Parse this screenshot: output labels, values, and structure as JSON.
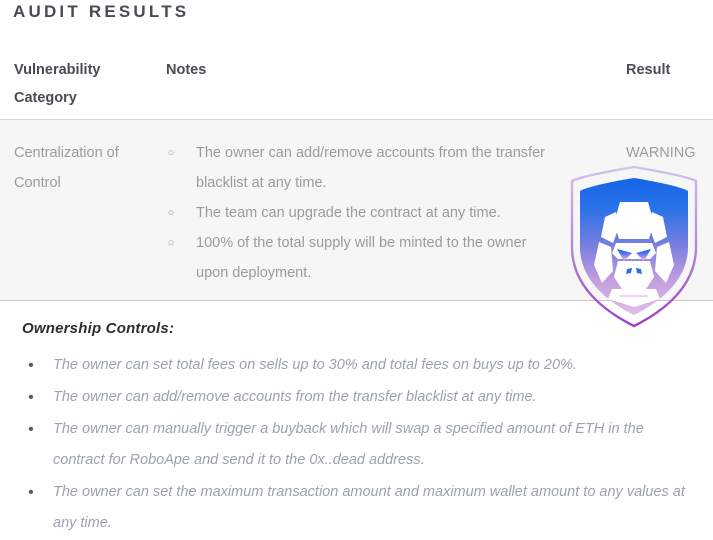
{
  "page": {
    "title": "AUDIT RESULTS"
  },
  "table": {
    "headers": {
      "category": "Vulnerability Category",
      "notes": "Notes",
      "result": "Result"
    },
    "rows": [
      {
        "category": "Centralization of Control",
        "notes": [
          "The owner can add/remove accounts from the transfer blacklist at any time.",
          "The team can upgrade the contract at any time.",
          "100% of the total supply will be minted to the owner upon deployment."
        ],
        "note_marker": "○",
        "result": "WARNING"
      }
    ]
  },
  "ownership_controls": {
    "heading": "Ownership Controls:",
    "bullet": "•",
    "items": [
      "The owner can set total fees on sells up to 30% and total fees on buys up to 20%.",
      "The owner can add/remove accounts from the transfer blacklist at any time.",
      "The owner can manually trigger a buyback which will swap a specified amount of ETH in the contract for RoboApe and send it to the 0x..dead address.",
      "The owner can set the maximum transaction amount and maximum wallet amount to any values at any time."
    ]
  },
  "watermark": {
    "icon": "shield-ape-logo",
    "gradient_top": "#1f6fe5",
    "gradient_bottom": "#d3a6e0",
    "outline": "#a24fc9"
  },
  "colors": {
    "title_text": "#4b4b53",
    "header_text": "#4b4b53",
    "body_text": "#9b9b9b",
    "controls_text": "#9aa2b1",
    "row_background": "#f6f6f6",
    "divider": "#c9c9c9"
  }
}
